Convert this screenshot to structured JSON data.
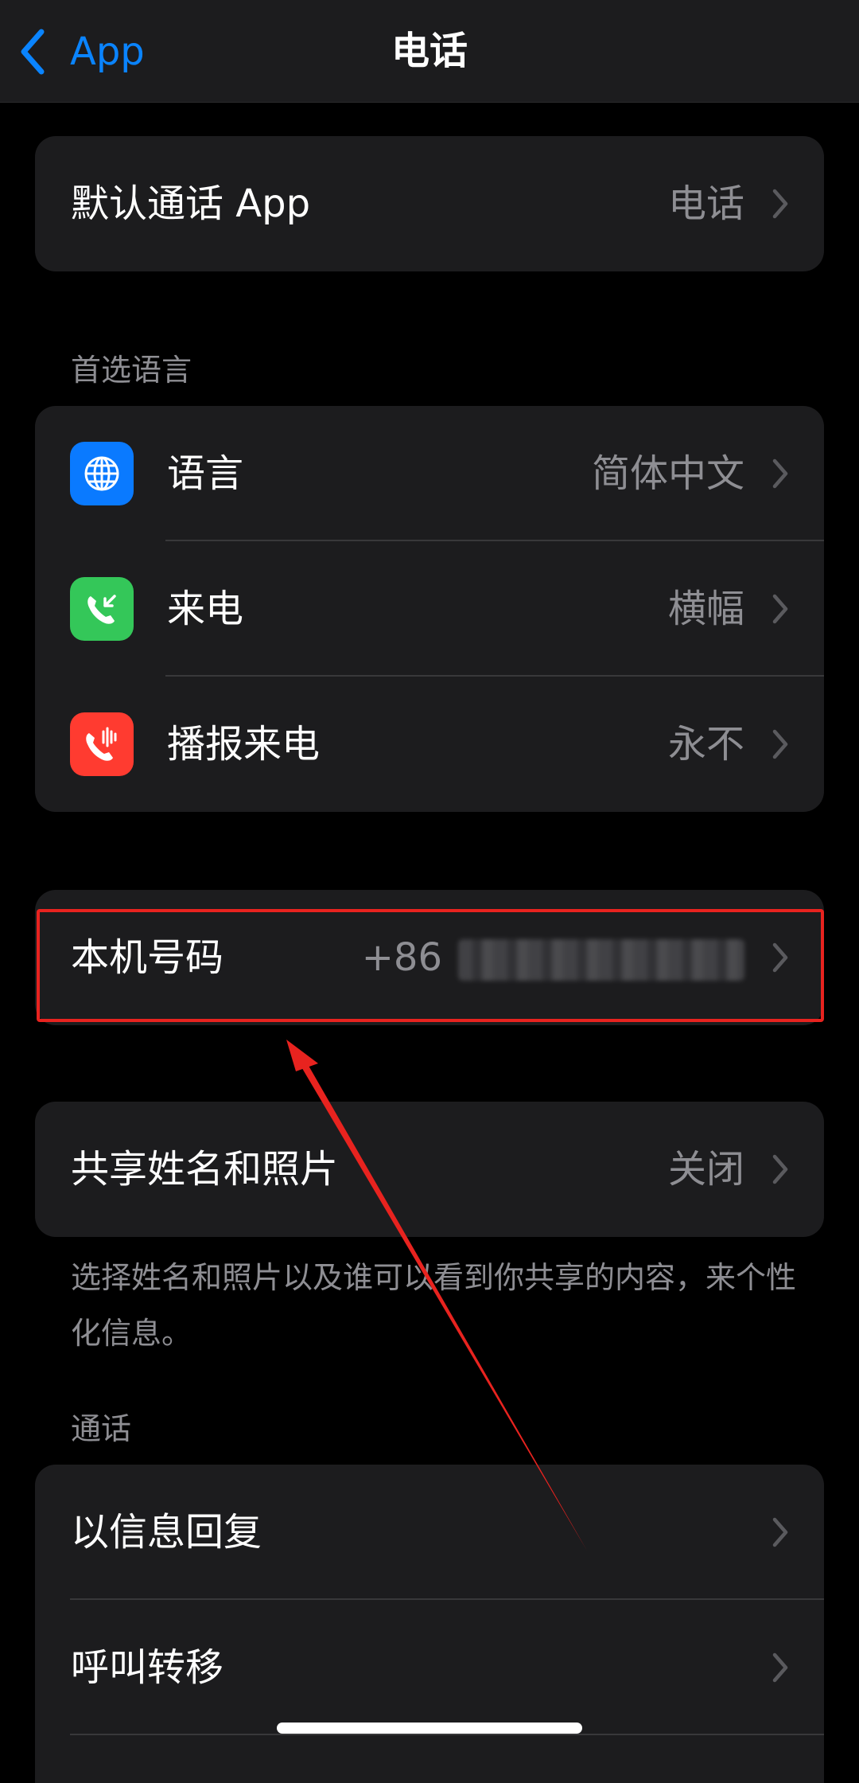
{
  "nav": {
    "back_label": "App",
    "title": "电话"
  },
  "default_call_app": {
    "label": "默认通话 App",
    "value": "电话"
  },
  "preferred_language": {
    "header": "首选语言",
    "items": [
      {
        "label": "语言",
        "value": "简体中文",
        "icon": "globe-icon",
        "color": "#0a7aff"
      },
      {
        "label": "来电",
        "value": "横幅",
        "icon": "incoming-call-icon",
        "color": "#34c759"
      },
      {
        "label": "播报来电",
        "value": "永不",
        "icon": "announce-call-icon",
        "color": "#ff3b30"
      }
    ]
  },
  "my_number": {
    "label": "本机号码",
    "prefix": "+86"
  },
  "share_name_photo": {
    "label": "共享姓名和照片",
    "value": "关闭",
    "footer": "选择姓名和照片以及谁可以看到你共享的内容，来个性化信息。"
  },
  "calls": {
    "header": "通话",
    "items": [
      {
        "label": "以信息回复"
      },
      {
        "label": "呼叫转移"
      }
    ]
  },
  "colors": {
    "accent": "#0a84ff",
    "highlight": "#e8231f",
    "secondary_text": "#8e8e93"
  }
}
